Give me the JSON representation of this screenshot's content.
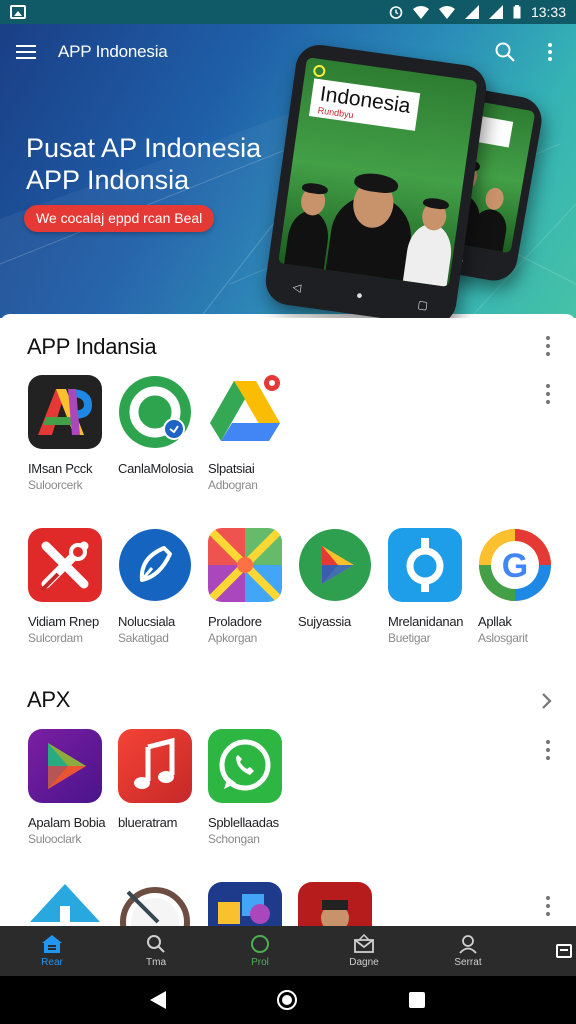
{
  "status_bar": {
    "time": "13:33",
    "alarm_icon": "alarm-icon",
    "wifi_icon": "wifi-icon",
    "signal_icon": "signal-icon",
    "battery_icon": "battery-icon"
  },
  "app_bar": {
    "title": "APP Indonesia"
  },
  "hero": {
    "title_line1": "Pusat AP Indonesia",
    "title_line2": "APP Indonsia",
    "cta": "We cocalaj eppd rcan Beal",
    "phone_screen_title": "Indonesia",
    "phone_screen_subtitle": "Rundbyu"
  },
  "sections": [
    {
      "title": "APP Indansia",
      "apps": [
        {
          "name": "IMsan Pcck",
          "sub": "Suloorcerk"
        },
        {
          "name": "CanlaMolosia",
          "sub": ""
        },
        {
          "name": "Slpatsiai",
          "sub": "Adbogran"
        }
      ]
    },
    {
      "title": "",
      "apps": [
        {
          "name": "Vidiam Rnep",
          "sub": "Sulcordam"
        },
        {
          "name": "Nolucsiala",
          "sub": "Sakatigad"
        },
        {
          "name": "Proladore",
          "sub": "Apkorgan"
        },
        {
          "name": "Sujyassia",
          "sub": ""
        },
        {
          "name": "Mrelanidanan",
          "sub": "Buetigar"
        },
        {
          "name": "Apllak",
          "sub": "Aslosgarit"
        }
      ]
    },
    {
      "title": "APX",
      "apps": [
        {
          "name": "Apalam Bobia",
          "sub": "Sulooclark"
        },
        {
          "name": "blueratram",
          "sub": ""
        },
        {
          "name": "Spblellaadas",
          "sub": "Schongan"
        }
      ]
    }
  ],
  "bottom_nav": [
    {
      "label": "Rear",
      "icon": "home-icon"
    },
    {
      "label": "Tma",
      "icon": "search-icon"
    },
    {
      "label": "Prol",
      "icon": "circle-icon"
    },
    {
      "label": "Dagne",
      "icon": "mail-icon"
    },
    {
      "label": "Serrat",
      "icon": "person-icon"
    }
  ],
  "colors": {
    "accent": "#2196f3",
    "cta_red": "#e53935",
    "status_bar": "#0f5a66"
  }
}
